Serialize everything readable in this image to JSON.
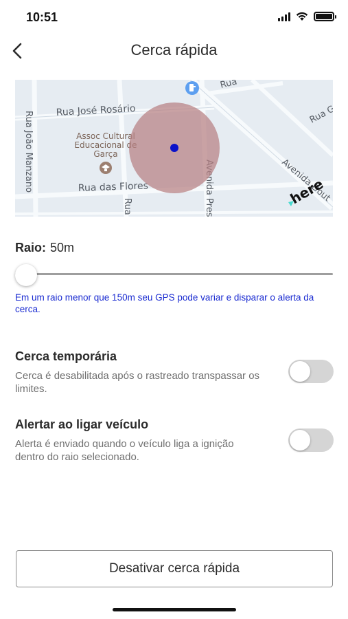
{
  "status_bar": {
    "time": "10:51",
    "icons": [
      "signal-bars-icon",
      "wifi-icon",
      "battery-icon"
    ]
  },
  "header": {
    "title": "Cerca rápida",
    "back_icon": "chevron-left-icon"
  },
  "map": {
    "streets": {
      "rua_top": "Rua",
      "rua_jose_rosario": "Rua José Rosário",
      "rua_joao_manzano": "Rua João Manzano",
      "rua_das_flores": "Rua das Flores",
      "rua_vertical": "Rua",
      "avenida_pres": "Avenida Pres",
      "avenida_dout": "Avenida Dout",
      "rua_right": "Rua G"
    },
    "poi": {
      "line1": "Assoc Cultural",
      "line2": "Educacional de",
      "line3": "Garça"
    },
    "provider_logo": "here",
    "colors": {
      "fence_fill": "#b77f82",
      "center_dot": "#0a11c9",
      "water": "#e6ecf2",
      "road": "#f7fafc"
    }
  },
  "radius": {
    "label": "Raio:",
    "value": "50m",
    "slider_level": 0,
    "hint": "Em um raio menor que 150m seu GPS pode variar e disparar o alerta da cerca."
  },
  "settings": [
    {
      "title": "Cerca temporária",
      "description": "Cerca é desabilitada após o rastreado transpassar os limites.",
      "enabled": false
    },
    {
      "title": "Alertar ao ligar veículo",
      "description": "Alerta é enviado quando o veículo liga a ignição dentro do raio selecionado.",
      "enabled": false
    }
  ],
  "actions": {
    "deactivate_label": "Desativar cerca rápida"
  },
  "colors": {
    "accent_text": "#1a2bd1",
    "toggle_off": "#d5d5d5"
  }
}
